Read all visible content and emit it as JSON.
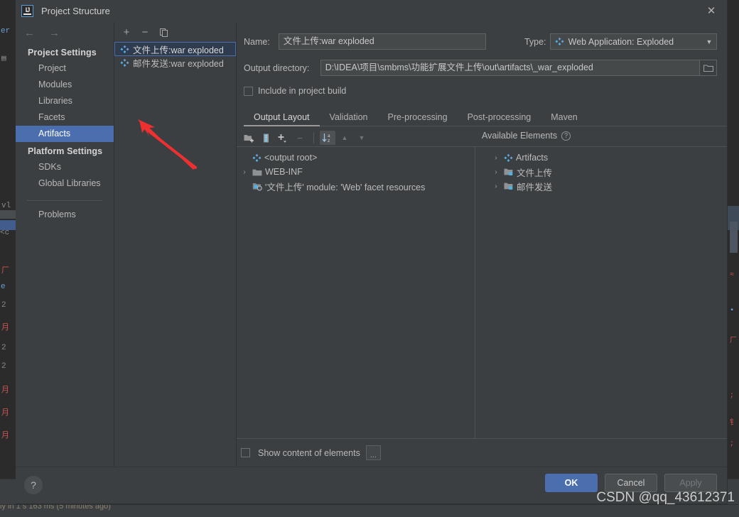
{
  "window": {
    "title": "Project Structure",
    "logo_text": "IJ",
    "close_icon": "✕"
  },
  "nav": {
    "back_icon": "←",
    "forward_icon": "→",
    "groups": [
      {
        "title": "Project Settings",
        "items": [
          {
            "label": "Project",
            "selected": false
          },
          {
            "label": "Modules",
            "selected": false
          },
          {
            "label": "Libraries",
            "selected": false
          },
          {
            "label": "Facets",
            "selected": false
          },
          {
            "label": "Artifacts",
            "selected": true
          }
        ]
      },
      {
        "title": "Platform Settings",
        "items": [
          {
            "label": "SDKs",
            "selected": false
          },
          {
            "label": "Global Libraries",
            "selected": false
          }
        ]
      }
    ],
    "problems": {
      "label": "Problems"
    }
  },
  "artifact_list": {
    "toolbar": {
      "add_label": "+",
      "remove_label": "−",
      "copy_label": "⧉"
    },
    "items": [
      {
        "label": "文件上传:war exploded",
        "selected": true
      },
      {
        "label": "邮件发送:war exploded",
        "selected": false
      }
    ]
  },
  "editor": {
    "name_label": "Name:",
    "name_value": "文件上传:war exploded",
    "type_label": "Type:",
    "type_value": "Web Application: Exploded",
    "output_dir_label": "Output directory:",
    "output_dir_value": "D:\\IDEA\\项目\\smbms\\功能扩展文件上传\\out\\artifacts\\_war_exploded",
    "include_in_build_label": "Include in project build",
    "include_in_build_checked": false,
    "tabs": [
      {
        "label": "Output Layout",
        "active": true
      },
      {
        "label": "Validation",
        "active": false
      },
      {
        "label": "Pre-processing",
        "active": false
      },
      {
        "label": "Post-processing",
        "active": false
      },
      {
        "label": "Maven",
        "active": false
      }
    ],
    "layout_toolbar": {
      "create_directory_icon": "create-directory-icon",
      "create_archive_icon": "create-archive-icon",
      "add_copy_icon": "+",
      "remove_icon": "−",
      "sort_icon": "sort-az-icon",
      "move_up_icon": "▲",
      "move_down_icon": "▼"
    },
    "available_elements_label": "Available Elements",
    "available_elements_help": "?",
    "output_tree": [
      {
        "twisty": "",
        "icon": "artifact-icon",
        "label": "<output root>",
        "indent": 0
      },
      {
        "twisty": "›",
        "icon": "folder-icon",
        "label": "WEB-INF",
        "indent": 0
      },
      {
        "twisty": "",
        "icon": "module-facet-icon",
        "label": "'文件上传' module: 'Web' facet resources",
        "indent": 0
      }
    ],
    "available_tree": [
      {
        "twisty": "›",
        "icon": "artifact-icon",
        "label": "Artifacts"
      },
      {
        "twisty": "›",
        "icon": "module-icon",
        "label": "文件上传"
      },
      {
        "twisty": "›",
        "icon": "module-icon",
        "label": "邮件发送"
      }
    ],
    "show_content_label": "Show content of elements",
    "show_content_checked": false,
    "more_button_label": "..."
  },
  "footer": {
    "help_label": "?",
    "ok_label": "OK",
    "cancel_label": "Cancel",
    "apply_label": "Apply"
  },
  "watermark": {
    "text": "CSDN @qq_43612371"
  },
  "status_bar": {
    "text": "ly in 1 s 163 ms (5 minutes ago)"
  },
  "colors": {
    "accent": "#4b6eaf",
    "dialog_bg": "#3c3f41",
    "field_bg": "#45494a",
    "annotation_red": "#f03030"
  }
}
